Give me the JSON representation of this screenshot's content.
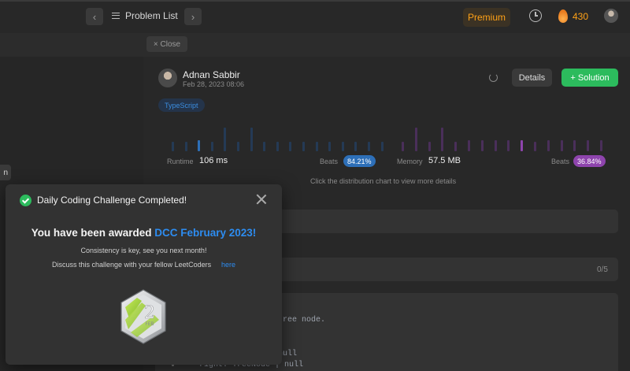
{
  "topbar": {
    "prev_icon": "chevron-left-icon",
    "next_icon": "chevron-right-icon",
    "problem_list_label": "Problem List",
    "premium_label": "Premium",
    "streak_count": "430",
    "accent_color": "#ffa116"
  },
  "close_tab": {
    "label": "× Close"
  },
  "submission": {
    "user_name": "Adnan Sabbir",
    "date": "Feb 28, 2023 08:06",
    "details_label": "Details",
    "solution_label": "+ Solution",
    "language": "TypeScript",
    "runtime_label": "Runtime",
    "runtime_value": "106 ms",
    "runtime_beats_label": "Beats",
    "runtime_beats": "84.21%",
    "memory_label": "Memory",
    "memory_value": "57.5 MB",
    "memory_beats_label": "Beats",
    "memory_beats": "36.84%",
    "distribution_hint": "Click the distribution chart to view more details",
    "runtime_color": "#2d6fb8",
    "memory_color": "#8e44ad"
  },
  "notes": {
    "score": "0/5"
  },
  "code": {
    "line1": "y tree node.",
    "line2": "null",
    "line3": "right: TreeNode | null"
  },
  "left_panel": {
    "pill_text": "n"
  },
  "modal": {
    "title": "Daily Coding Challenge Completed!",
    "award_prefix": "You have been awarded ",
    "award_highlight": "DCC February 2023!",
    "message1": "Consistency is key, see you next month!",
    "message2": "Discuss this challenge with your fellow LeetCoders",
    "link_label": "here",
    "badge_number": "2",
    "badge_month": "FEB"
  }
}
